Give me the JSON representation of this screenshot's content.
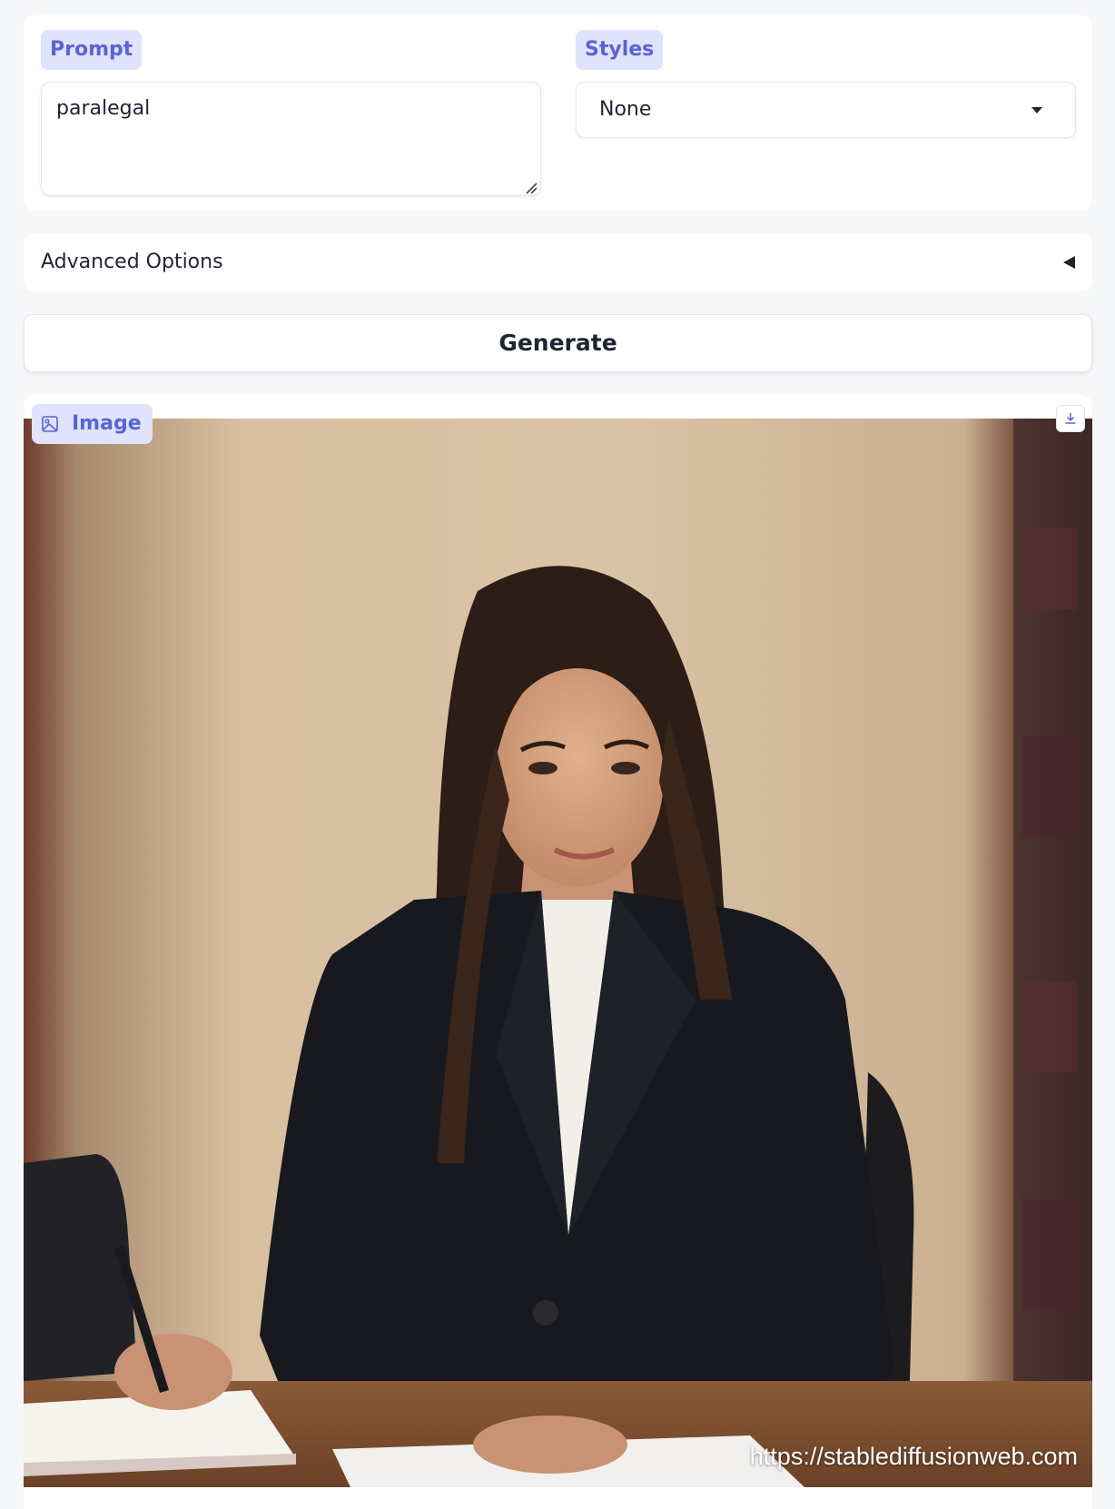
{
  "prompt": {
    "label": "Prompt",
    "value": "paralegal"
  },
  "styles": {
    "label": "Styles",
    "selected": "None"
  },
  "advanced": {
    "title": "Advanced Options"
  },
  "generate": {
    "label": "Generate"
  },
  "output": {
    "label": "Image",
    "watermark": "https://stablediffusionweb.com"
  },
  "colors": {
    "accent": "#5b63d4",
    "chip_bg": "#dfe3fb",
    "page_bg": "#f6f7f9"
  }
}
